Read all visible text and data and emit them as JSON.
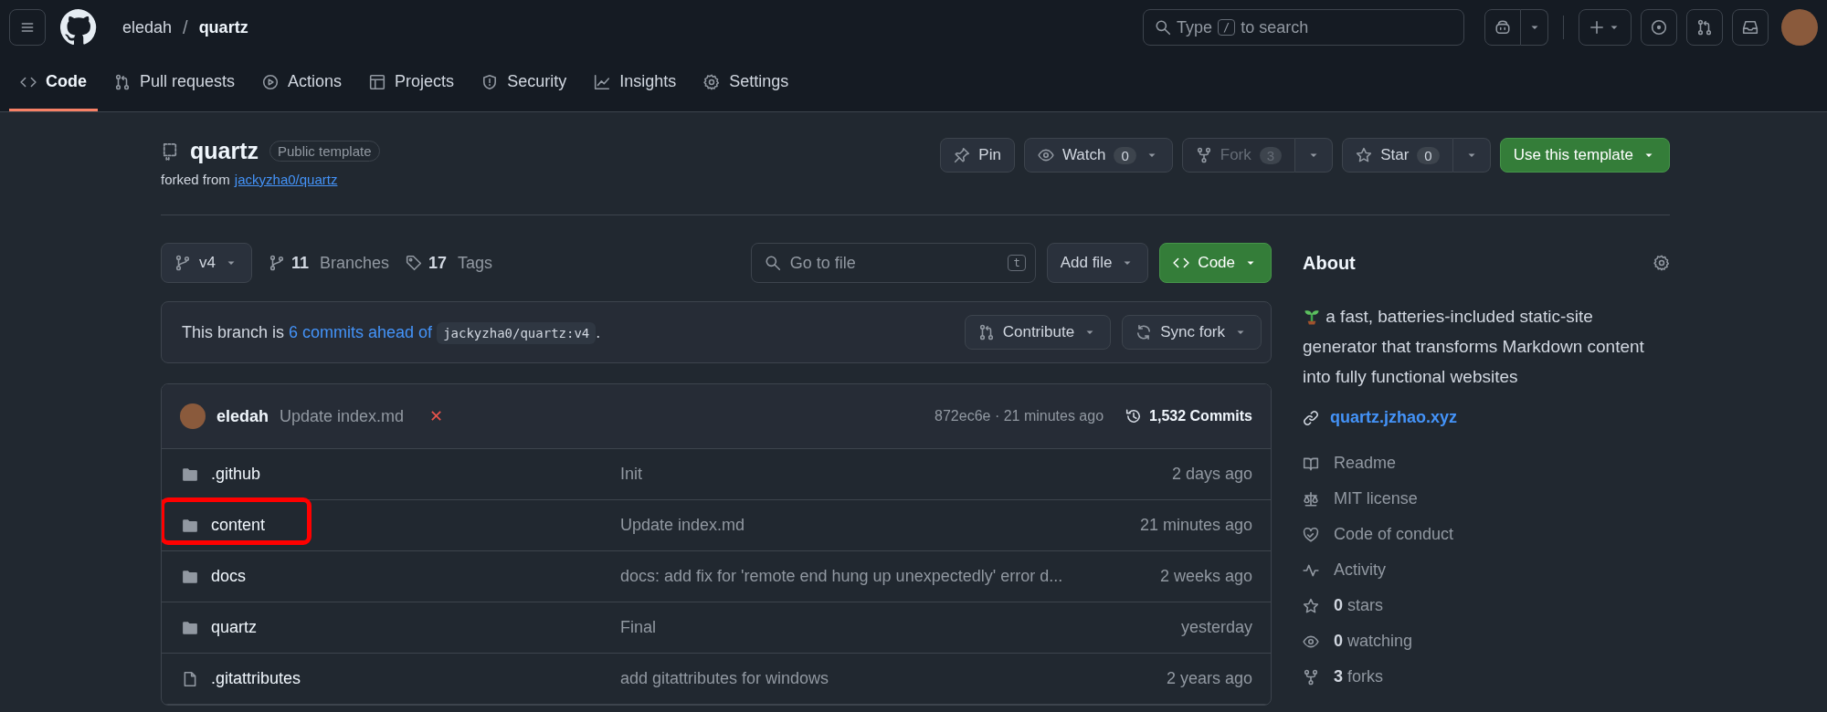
{
  "header": {
    "owner": "eledah",
    "separator": "/",
    "repo": "quartz",
    "search": {
      "placeholder_pre": "Type",
      "key": "/",
      "placeholder_post": "to search"
    }
  },
  "tabs": [
    {
      "label": "Code",
      "selected": true
    },
    {
      "label": "Pull requests",
      "selected": false
    },
    {
      "label": "Actions",
      "selected": false
    },
    {
      "label": "Projects",
      "selected": false
    },
    {
      "label": "Security",
      "selected": false
    },
    {
      "label": "Insights",
      "selected": false
    },
    {
      "label": "Settings",
      "selected": false
    }
  ],
  "repo": {
    "name": "quartz",
    "badge": "Public template",
    "forked_prefix": "forked from",
    "forked_link": "jackyzha0/quartz",
    "actions": [
      {
        "kind": "plain",
        "label": "Pin",
        "disabled": false
      },
      {
        "kind": "count",
        "label": "Watch",
        "count": "0",
        "disabled": false
      },
      {
        "kind": "split",
        "label": "Fork",
        "count": "3",
        "disabled": true
      },
      {
        "kind": "split",
        "label": "Star",
        "count": "0",
        "disabled": false
      },
      {
        "kind": "primary",
        "label": "Use this template",
        "disabled": false
      }
    ]
  },
  "toolbar": {
    "branch": "v4",
    "branches_count": "11",
    "branches_label": "Branches",
    "tags_count": "17",
    "tags_label": "Tags",
    "go_to_file": {
      "placeholder": "Go to file",
      "key": "t"
    },
    "add_file": "Add file",
    "code": "Code"
  },
  "fork_status": {
    "prefix": "This branch is",
    "link": "6 commits ahead of",
    "ref": "jackyzha0/quartz:v4",
    "suffix": ".",
    "contribute": "Contribute",
    "sync": "Sync fork"
  },
  "latest_commit": {
    "author": "eledah",
    "message": "Update index.md",
    "status": "✕",
    "meta": "872ec6e · 21 minutes ago",
    "commits": "1,532 Commits"
  },
  "files": [
    {
      "kind": "folder",
      "name": ".github",
      "message": "Init",
      "time": "2 days ago",
      "highlighted": false
    },
    {
      "kind": "folder",
      "name": "content",
      "message": "Update index.md",
      "time": "21 minutes ago",
      "highlighted": true
    },
    {
      "kind": "folder",
      "name": "docs",
      "message": "docs: add fix for 'remote end hung up unexpectedly' error d...",
      "time": "2 weeks ago",
      "highlighted": false
    },
    {
      "kind": "folder",
      "name": "quartz",
      "message": "Final",
      "time": "yesterday",
      "highlighted": false
    },
    {
      "kind": "file",
      "name": ".gitattributes",
      "message": "add gitattributes for windows",
      "time": "2 years ago",
      "highlighted": false
    }
  ],
  "about": {
    "title": "About",
    "description": "a fast, batteries-included static-site generator that transforms Markdown content into fully functional websites",
    "website": "quartz.jzhao.xyz",
    "items": [
      "Readme",
      "MIT license",
      "Code of conduct",
      "Activity",
      "**0** stars",
      "**0** watching",
      "**3** forks"
    ]
  }
}
